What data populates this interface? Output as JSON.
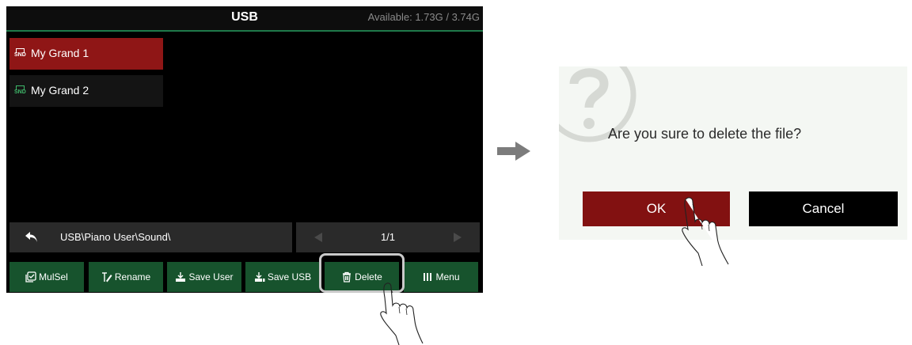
{
  "screen": {
    "title": "USB",
    "available": "Available: 1.73G / 3.74G",
    "files": [
      {
        "icon_text": "SND",
        "name": "My Grand 1"
      },
      {
        "icon_text": "SND",
        "name": "My Grand 2"
      }
    ],
    "path": "USB\\Piano User\\Sound\\",
    "page": "1/1",
    "buttons": {
      "mulsel": "MulSel",
      "rename": "Rename",
      "save_user": "Save User",
      "save_usb": "Save USB",
      "delete": "Delete",
      "menu": "Menu"
    }
  },
  "dialog": {
    "message": "Are you sure to delete the file?",
    "ok": "OK",
    "cancel": "Cancel"
  },
  "icons": {
    "question": "question-mark-icon",
    "back": "back-arrow-icon",
    "prev": "triangle-left-icon",
    "next": "triangle-right-icon",
    "transition": "right-arrow-icon",
    "pointer": "pointing-hand-icon"
  },
  "colors": {
    "selected_item": "#8f1616",
    "function_button": "#17532d",
    "ok_button": "#821111",
    "title_underline": "#1f7a4a"
  }
}
